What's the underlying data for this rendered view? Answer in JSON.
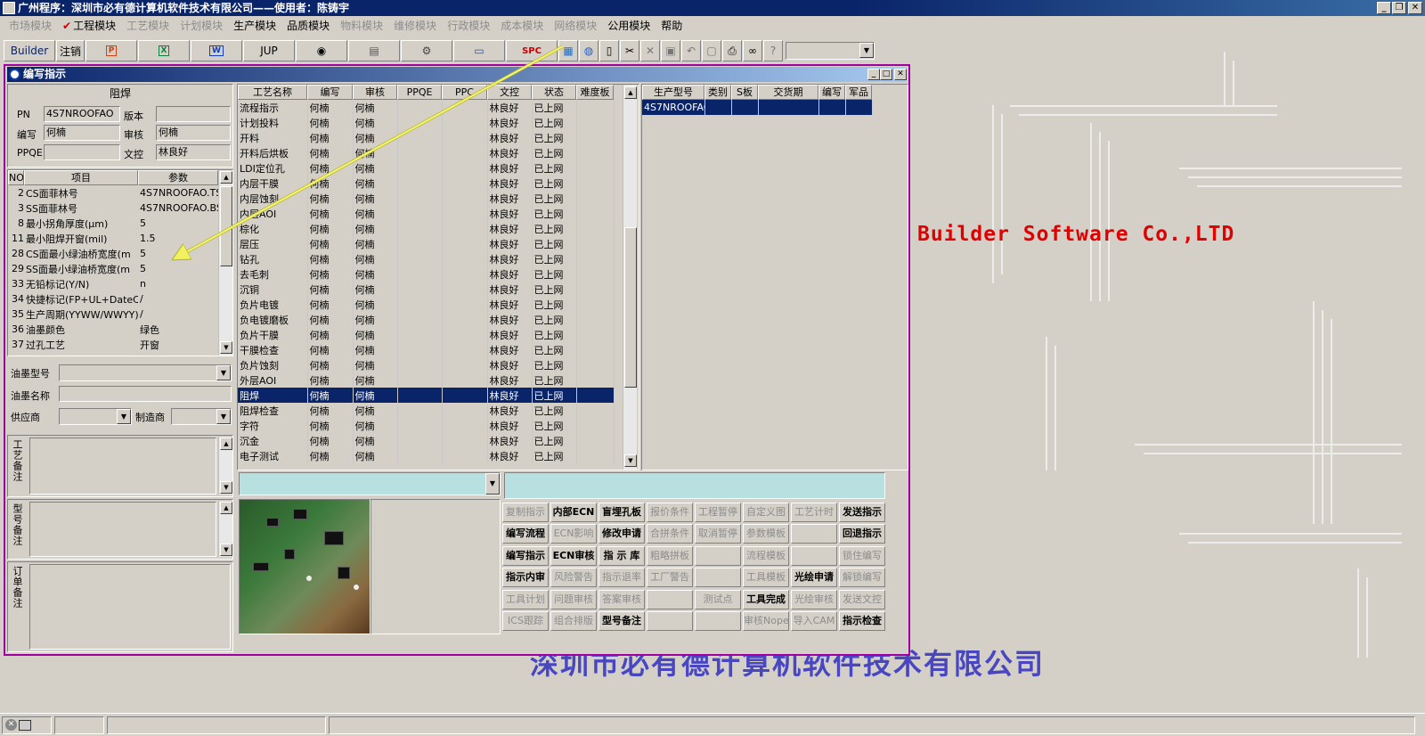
{
  "window": {
    "title": "广州程序：深圳市必有德计算机软件技术有限公司——使用者：陈铸宇"
  },
  "menu": [
    {
      "label": "市场模块",
      "enabled": false
    },
    {
      "label": "工程模块",
      "enabled": true,
      "checked": true
    },
    {
      "label": "工艺模块",
      "enabled": false
    },
    {
      "label": "计划模块",
      "enabled": false
    },
    {
      "label": "生产模块",
      "enabled": true
    },
    {
      "label": "品质模块",
      "enabled": true
    },
    {
      "label": "物料模块",
      "enabled": false
    },
    {
      "label": "维修模块",
      "enabled": false
    },
    {
      "label": "行政模块",
      "enabled": false
    },
    {
      "label": "成本模块",
      "enabled": false
    },
    {
      "label": "网络模块",
      "enabled": false
    },
    {
      "label": "公用模块",
      "enabled": true
    },
    {
      "label": "帮助",
      "enabled": true
    }
  ],
  "toolbar": {
    "builder": "Builder",
    "logout": "注销",
    "jup": "JUP",
    "spc": "SPC",
    "icons": [
      "powerpoint-icon",
      "excel-icon",
      "word-icon",
      "eye-icon",
      "database-icon",
      "tools-icon",
      "computer-icon"
    ],
    "small_icons": [
      "calendar-icon",
      "globe-icon",
      "new-page-icon",
      "cut-icon",
      "delete-icon",
      "save-icon",
      "undo-icon",
      "preview-icon",
      "print-icon",
      "binoculars-icon",
      "help-icon"
    ]
  },
  "child": {
    "title": "编写指示"
  },
  "left": {
    "section_title": "阻焊",
    "pn_label": "PN",
    "pn_value": "4S7NROOFAO",
    "version_label": "版本",
    "version_value": "",
    "writer_label": "编写",
    "writer_value": "何楠",
    "audit_label": "审核",
    "audit_value": "何楠",
    "ppqe_label": "PPQE",
    "ppqe_value": "",
    "doc_label": "文控",
    "doc_value": "林良好",
    "param_headers": [
      "NO",
      "项目",
      "参数"
    ],
    "params": [
      [
        "2",
        "CS面菲林号",
        "4S7NROOFAO.TS"
      ],
      [
        "3",
        "SS面菲林号",
        "4S7NROOFAO.BS"
      ],
      [
        "8",
        "最小拐角厚度(μm)",
        "5"
      ],
      [
        "11",
        "最小阻焊开窗(mil)",
        "1.5"
      ],
      [
        "28",
        "CS面最小绿油桥宽度(m",
        "5"
      ],
      [
        "29",
        "SS面最小绿油桥宽度(m",
        "5"
      ],
      [
        "33",
        "无铅标记(Y/N)",
        "n"
      ],
      [
        "34",
        "快捷标记(FP+UL+DateCo",
        "/"
      ],
      [
        "35",
        "生产周期(YYWW/WWYY)",
        "/"
      ],
      [
        "36",
        "油墨颜色",
        "绿色"
      ],
      [
        "37",
        "过孔工艺",
        "开窗"
      ]
    ],
    "ink_type_label": "油墨型号",
    "ink_type_value": "",
    "ink_name_label": "油墨名称",
    "ink_name_value": "",
    "supplier_label": "供应商",
    "supplier_value": "",
    "maker_label": "制造商",
    "maker_value": "",
    "process_note_label": "工艺备注",
    "model_note_label": "型号备注",
    "order_note_label": "订单备注"
  },
  "process_grid": {
    "headers": [
      "工艺名称",
      "编写",
      "审核",
      "PPQE",
      "PPC",
      "文控",
      "状态",
      "难度板"
    ],
    "rows": [
      [
        "流程指示",
        "何楠",
        "何楠",
        "",
        "",
        "林良好",
        "已上网",
        ""
      ],
      [
        "计划投料",
        "何楠",
        "何楠",
        "",
        "",
        "林良好",
        "已上网",
        ""
      ],
      [
        "开料",
        "何楠",
        "何楠",
        "",
        "",
        "林良好",
        "已上网",
        ""
      ],
      [
        "开料后烘板",
        "何楠",
        "何楠",
        "",
        "",
        "林良好",
        "已上网",
        ""
      ],
      [
        "LDI定位孔",
        "何楠",
        "何楠",
        "",
        "",
        "林良好",
        "已上网",
        ""
      ],
      [
        "内层干膜",
        "何楠",
        "何楠",
        "",
        "",
        "林良好",
        "已上网",
        ""
      ],
      [
        "内层蚀刻",
        "何楠",
        "何楠",
        "",
        "",
        "林良好",
        "已上网",
        ""
      ],
      [
        "内层AOI",
        "何楠",
        "何楠",
        "",
        "",
        "林良好",
        "已上网",
        ""
      ],
      [
        "棕化",
        "何楠",
        "何楠",
        "",
        "",
        "林良好",
        "已上网",
        ""
      ],
      [
        "层压",
        "何楠",
        "何楠",
        "",
        "",
        "林良好",
        "已上网",
        ""
      ],
      [
        "钻孔",
        "何楠",
        "何楠",
        "",
        "",
        "林良好",
        "已上网",
        ""
      ],
      [
        "去毛刺",
        "何楠",
        "何楠",
        "",
        "",
        "林良好",
        "已上网",
        ""
      ],
      [
        "沉铜",
        "何楠",
        "何楠",
        "",
        "",
        "林良好",
        "已上网",
        ""
      ],
      [
        "负片电镀",
        "何楠",
        "何楠",
        "",
        "",
        "林良好",
        "已上网",
        ""
      ],
      [
        "负电镀磨板",
        "何楠",
        "何楠",
        "",
        "",
        "林良好",
        "已上网",
        ""
      ],
      [
        "负片干膜",
        "何楠",
        "何楠",
        "",
        "",
        "林良好",
        "已上网",
        ""
      ],
      [
        "干膜检查",
        "何楠",
        "何楠",
        "",
        "",
        "林良好",
        "已上网",
        ""
      ],
      [
        "负片蚀刻",
        "何楠",
        "何楠",
        "",
        "",
        "林良好",
        "已上网",
        ""
      ],
      [
        "外层AOI",
        "何楠",
        "何楠",
        "",
        "",
        "林良好",
        "已上网",
        ""
      ],
      [
        "阻焊",
        "何楠",
        "何楠",
        "",
        "",
        "林良好",
        "已上网",
        ""
      ],
      [
        "阻焊检查",
        "何楠",
        "何楠",
        "",
        "",
        "林良好",
        "已上网",
        ""
      ],
      [
        "字符",
        "何楠",
        "何楠",
        "",
        "",
        "林良好",
        "已上网",
        ""
      ],
      [
        "沉金",
        "何楠",
        "何楠",
        "",
        "",
        "林良好",
        "已上网",
        ""
      ],
      [
        "电子测试",
        "何楠",
        "何楠",
        "",
        "",
        "林良好",
        "已上网",
        ""
      ]
    ],
    "selected_row": "阻焊"
  },
  "model_grid": {
    "headers": [
      "生产型号",
      "类别",
      "S板",
      "交货期",
      "编写",
      "军品"
    ],
    "rows": [
      [
        "4S7NROOFAO",
        "",
        "",
        "",
        "",
        ""
      ]
    ]
  },
  "buttons": [
    [
      "复制指示",
      "内部ECN",
      "盲埋孔板",
      "报价条件",
      "工程暂停",
      "自定义图",
      "工艺计时",
      "发送指示"
    ],
    [
      "编写流程",
      "ECN影响",
      "修改申请",
      "合拼条件",
      "取消暂停",
      "参数模板",
      "",
      "回退指示"
    ],
    [
      "编写指示",
      "ECN审核",
      "指 示 库",
      "粗略拼板",
      "",
      "流程模板",
      "",
      "锁住编写"
    ],
    [
      "指示内审",
      "风险警告",
      "指示退率",
      "工厂警告",
      "",
      "工具模板",
      "光绘申请",
      "解锁编写"
    ],
    [
      "工具计划",
      "问题审核",
      "答案审核",
      "",
      "测试点",
      "工具完成",
      "光绘审核",
      "发送文控"
    ],
    [
      "ICS跟踪",
      "组合排版",
      "型号备注",
      "",
      "",
      "审核Nope",
      "导入CAM",
      "指示检查"
    ]
  ],
  "buttons_enabled": [
    [
      false,
      true,
      true,
      false,
      false,
      false,
      false,
      true
    ],
    [
      true,
      false,
      true,
      false,
      false,
      false,
      false,
      true
    ],
    [
      true,
      true,
      true,
      false,
      false,
      false,
      false,
      false
    ],
    [
      true,
      false,
      false,
      false,
      false,
      false,
      true,
      false
    ],
    [
      false,
      false,
      false,
      false,
      false,
      true,
      false,
      false
    ],
    [
      false,
      false,
      true,
      false,
      false,
      false,
      false,
      true
    ]
  ],
  "branding": {
    "english": "Builder Software Co.,LTD",
    "chinese": "深圳市必有德计算机软件技术有限公司"
  },
  "colors": {
    "title_active": "#0a246a",
    "selection": "#0a246a",
    "brand_red": "#e00000",
    "watermark_blue": "#3030c0",
    "child_border": "#a000a0",
    "info_panel": "#b8e0e0"
  }
}
